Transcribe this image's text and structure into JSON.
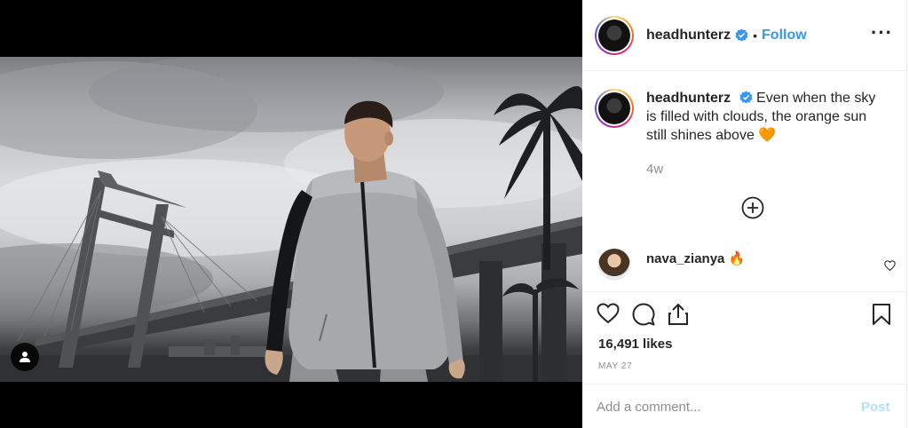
{
  "post": {
    "username": "headhunterz",
    "verified": true,
    "separator": "•",
    "follow_label": "Follow",
    "more_label": "···"
  },
  "caption": {
    "username": "headhunterz",
    "text": "Even when the sky is filled with clouds, the orange sun still shines above 🧡",
    "time": "4w"
  },
  "comments": [
    {
      "username": "nava_zianya",
      "text": "🔥"
    }
  ],
  "engagement": {
    "likes": "16,491 likes",
    "date": "MAY 27"
  },
  "comment_box": {
    "placeholder": "Add a comment...",
    "post_label": "Post"
  },
  "colors": {
    "accent": "#3897f0",
    "post_disabled": "#b2dffc",
    "muted": "#8e8e8e",
    "border": "#efefef"
  },
  "icons": [
    "user-tag-icon",
    "verified-badge-icon",
    "more-options-icon",
    "load-more-comments-icon",
    "like-icon",
    "comment-icon",
    "share-icon",
    "save-icon"
  ]
}
